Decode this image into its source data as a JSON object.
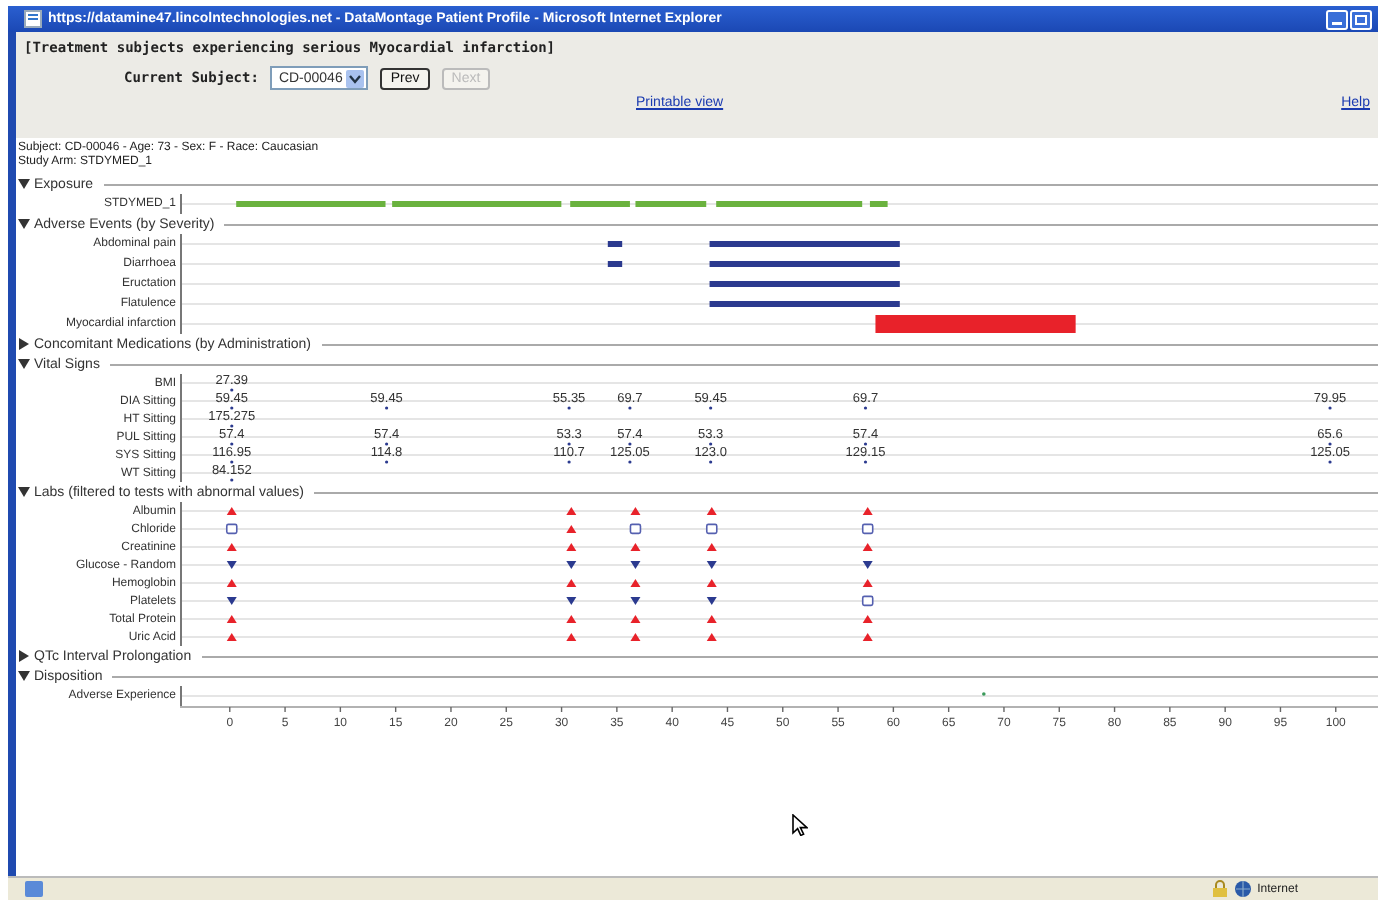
{
  "window": {
    "title": "https://datamine47.lincolntechnologies.net - DataMontage Patient Profile - Microsoft Internet Explorer"
  },
  "heading": "[Treatment subjects experiencing serious Myocardial infarction]",
  "subject_picker": {
    "label": "Current Subject:",
    "value": "CD-00046",
    "prev": {
      "label": "Prev",
      "disabled": false
    },
    "next": {
      "label": "Next",
      "disabled": true
    }
  },
  "links": {
    "printable": "Printable view",
    "help": "Help"
  },
  "subject_info": [
    "Subject: CD-00046 - Age: 73 - Sex: F - Race: Caucasian",
    "Study Arm: STDYMED_1"
  ],
  "timeline": {
    "sections": [
      {
        "title": "Exposure",
        "expanded": true,
        "kind": "bars",
        "rows": [
          {
            "label": "STDYMED_1",
            "segments": [
              {
                "color": "#6ab23e",
                "kind": "thin"
              },
              {
                "color": "#6ab23e",
                "kind": "thin"
              },
              {
                "color": "#6ab23e",
                "kind": "thin"
              },
              {
                "color": "#6ab23e",
                "kind": "thin"
              },
              {
                "color": "#6ab23e",
                "kind": "thin"
              },
              {
                "color": "#6ab23e",
                "kind": "thin"
              }
            ]
          }
        ]
      },
      {
        "title": "Adverse Events (by Severity)",
        "expanded": true,
        "kind": "bars",
        "rows": [
          {
            "label": "Abdominal pain",
            "segments": [
              {
                "color": "#2b3a8f",
                "kind": "thin"
              },
              {
                "color": "#2b3a8f",
                "kind": "thin"
              }
            ]
          },
          {
            "label": "Diarrhoea",
            "segments": [
              {
                "color": "#2b3a8f",
                "kind": "thin"
              },
              {
                "color": "#2b3a8f",
                "kind": "thin"
              }
            ]
          },
          {
            "label": "Eructation",
            "segments": [
              {
                "color": "#2b3a8f",
                "kind": "thin"
              }
            ]
          },
          {
            "label": "Flatulence",
            "segments": [
              {
                "color": "#2b3a8f",
                "kind": "thin"
              }
            ]
          },
          {
            "label": "Myocardial infarction",
            "segments": [
              {
                "color": "#e8222a",
                "kind": "thick"
              }
            ]
          }
        ]
      },
      {
        "title": "Concomitant Medications (by Administration)",
        "expanded": false
      },
      {
        "title": "Vital Signs",
        "expanded": true,
        "kind": "values",
        "rows": [
          {
            "label": "BMI",
            "values": [
              "27.39"
            ]
          },
          {
            "label": "DIA Sitting",
            "values": [
              "59.45",
              "59.45",
              "55.35",
              "69.7",
              "59.45",
              "69.7",
              "79.95"
            ]
          },
          {
            "label": "HT Sitting",
            "values": [
              "175.275"
            ]
          },
          {
            "label": "PUL Sitting",
            "values": [
              "57.4",
              "57.4",
              "53.3",
              "57.4",
              "53.3",
              "57.4",
              "65.6"
            ]
          },
          {
            "label": "SYS Sitting",
            "values": [
              "116.95",
              "114.8",
              "110.7",
              "125.05",
              "123.0",
              "129.15",
              "125.05"
            ]
          },
          {
            "label": "WT Sitting",
            "values": [
              "84.152"
            ]
          }
        ]
      },
      {
        "title": "Labs (filtered to tests with abnormal values)",
        "expanded": true,
        "kind": "markers",
        "rows": [
          {
            "label": "Albumin",
            "points": [
              {
                "kind": "high"
              },
              {
                "kind": "high"
              },
              {
                "kind": "high"
              },
              {
                "kind": "high"
              },
              {
                "kind": "high"
              }
            ]
          },
          {
            "label": "Chloride",
            "points": [
              {
                "kind": "normal"
              },
              {
                "kind": "high"
              },
              {
                "kind": "normal"
              },
              {
                "kind": "normal"
              },
              {
                "kind": "normal"
              }
            ]
          },
          {
            "label": "Creatinine",
            "points": [
              {
                "kind": "high"
              },
              {
                "kind": "high"
              },
              {
                "kind": "high"
              },
              {
                "kind": "high"
              },
              {
                "kind": "high"
              }
            ]
          },
          {
            "label": "Glucose - Random",
            "points": [
              {
                "kind": "low"
              },
              {
                "kind": "low"
              },
              {
                "kind": "low"
              },
              {
                "kind": "low"
              },
              {
                "kind": "low"
              }
            ]
          },
          {
            "label": "Hemoglobin",
            "points": [
              {
                "kind": "high"
              },
              {
                "kind": "high"
              },
              {
                "kind": "high"
              },
              {
                "kind": "high"
              },
              {
                "kind": "high"
              }
            ]
          },
          {
            "label": "Platelets",
            "points": [
              {
                "kind": "low"
              },
              {
                "kind": "low"
              },
              {
                "kind": "low"
              },
              {
                "kind": "low"
              },
              {
                "kind": "normal"
              }
            ]
          },
          {
            "label": "Total Protein",
            "points": [
              {
                "kind": "high"
              },
              {
                "kind": "high"
              },
              {
                "kind": "high"
              },
              {
                "kind": "high"
              },
              {
                "kind": "high"
              }
            ]
          },
          {
            "label": "Uric Acid",
            "points": [
              {
                "kind": "high"
              },
              {
                "kind": "high"
              },
              {
                "kind": "high"
              },
              {
                "kind": "high"
              },
              {
                "kind": "high"
              }
            ]
          }
        ]
      },
      {
        "title": "QTc Interval Prolongation",
        "expanded": false
      },
      {
        "title": "Disposition",
        "expanded": true,
        "kind": "dots",
        "rows": [
          {
            "label": "Adverse Experience",
            "points": [
              {
                "kind": "dot"
              }
            ]
          }
        ]
      }
    ],
    "axis_ticks": [
      "0",
      "5",
      "10",
      "15",
      "20",
      "25",
      "30",
      "35",
      "40",
      "45",
      "50",
      "55",
      "60",
      "65",
      "70",
      "75",
      "80",
      "85",
      "90",
      "95",
      "100"
    ]
  },
  "status_bar": {
    "zone": "Internet"
  }
}
